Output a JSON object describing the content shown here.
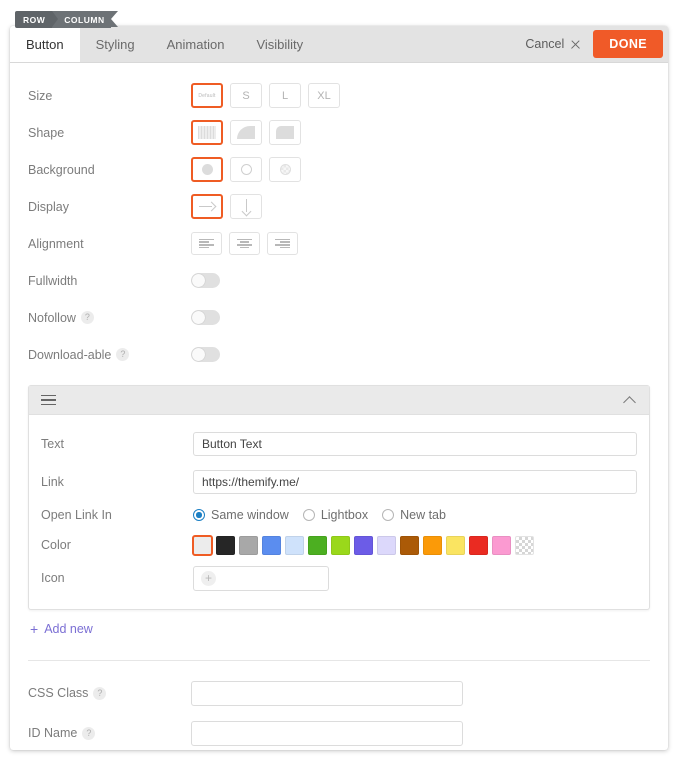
{
  "breadcrumb": {
    "row": "ROW",
    "column": "COLUMN"
  },
  "tabs": [
    {
      "label": "Button",
      "active": true
    },
    {
      "label": "Styling",
      "active": false
    },
    {
      "label": "Animation",
      "active": false
    },
    {
      "label": "Visibility",
      "active": false
    }
  ],
  "header": {
    "cancel_label": "Cancel",
    "cancel_icon": "close-icon",
    "done_label": "DONE",
    "done_color": "#f05a28"
  },
  "fields": {
    "size": {
      "label": "Size",
      "options": [
        {
          "label": "Default",
          "selected": true
        },
        {
          "label": "S",
          "selected": false
        },
        {
          "label": "L",
          "selected": false
        },
        {
          "label": "XL",
          "selected": false
        }
      ]
    },
    "shape": {
      "label": "Shape",
      "options": [
        {
          "icon": "square-shape-icon",
          "selected": true
        },
        {
          "icon": "rounded-large-shape-icon",
          "selected": false
        },
        {
          "icon": "rounded-small-shape-icon",
          "selected": false
        }
      ]
    },
    "background": {
      "label": "Background",
      "options": [
        {
          "icon": "filled-circle-icon",
          "selected": true
        },
        {
          "icon": "outline-circle-icon",
          "selected": false
        },
        {
          "icon": "transparent-circle-icon",
          "selected": false
        }
      ]
    },
    "display": {
      "label": "Display",
      "options": [
        {
          "icon": "arrow-right-icon",
          "selected": true
        },
        {
          "icon": "arrow-down-icon",
          "selected": false
        }
      ]
    },
    "alignment": {
      "label": "Alignment",
      "options": [
        {
          "icon": "align-left-icon",
          "selected": false
        },
        {
          "icon": "align-center-icon",
          "selected": false
        },
        {
          "icon": "align-right-icon",
          "selected": false
        }
      ]
    },
    "fullwidth": {
      "label": "Fullwidth",
      "on": false
    },
    "nofollow": {
      "label": "Nofollow",
      "help": "?",
      "on": false
    },
    "downloadable": {
      "label": "Download-able",
      "help": "?",
      "on": false
    }
  },
  "module": {
    "drag_icon": "drag-handle-icon",
    "collapse_icon": "chevron-up-icon",
    "text": {
      "label": "Text",
      "value": "Button Text",
      "placeholder": ""
    },
    "link": {
      "label": "Link",
      "value": "https://themify.me/",
      "placeholder": ""
    },
    "open_link_in": {
      "label": "Open Link In",
      "options": [
        {
          "label": "Same window",
          "selected": true
        },
        {
          "label": "Lightbox",
          "selected": false
        },
        {
          "label": "New tab",
          "selected": false
        }
      ]
    },
    "color": {
      "label": "Color",
      "swatches": [
        {
          "hex": "#ececec",
          "selected": true
        },
        {
          "hex": "#262626",
          "selected": false
        },
        {
          "hex": "#a8a8a8",
          "selected": false
        },
        {
          "hex": "#5b8def",
          "selected": false
        },
        {
          "hex": "#cfe2fb",
          "selected": false
        },
        {
          "hex": "#4caf21",
          "selected": false
        },
        {
          "hex": "#9ad81b",
          "selected": false
        },
        {
          "hex": "#6c5ce7",
          "selected": false
        },
        {
          "hex": "#dcd8fb",
          "selected": false
        },
        {
          "hex": "#ab5a07",
          "selected": false
        },
        {
          "hex": "#fb9a08",
          "selected": false
        },
        {
          "hex": "#fae461",
          "selected": false
        },
        {
          "hex": "#ea2b22",
          "selected": false
        },
        {
          "hex": "#fb9ad1",
          "selected": false
        },
        {
          "hex": "transparent",
          "selected": false
        }
      ]
    },
    "icon": {
      "label": "Icon",
      "add_glyph": "+",
      "value": ""
    }
  },
  "add_new": {
    "label": "Add new",
    "glyph": "+",
    "color": "#7b6fd4"
  },
  "bottom": {
    "css_class": {
      "label": "CSS Class",
      "help": "?",
      "value": "",
      "placeholder": ""
    },
    "id_name": {
      "label": "ID Name",
      "help": "?",
      "value": "",
      "placeholder": ""
    }
  }
}
